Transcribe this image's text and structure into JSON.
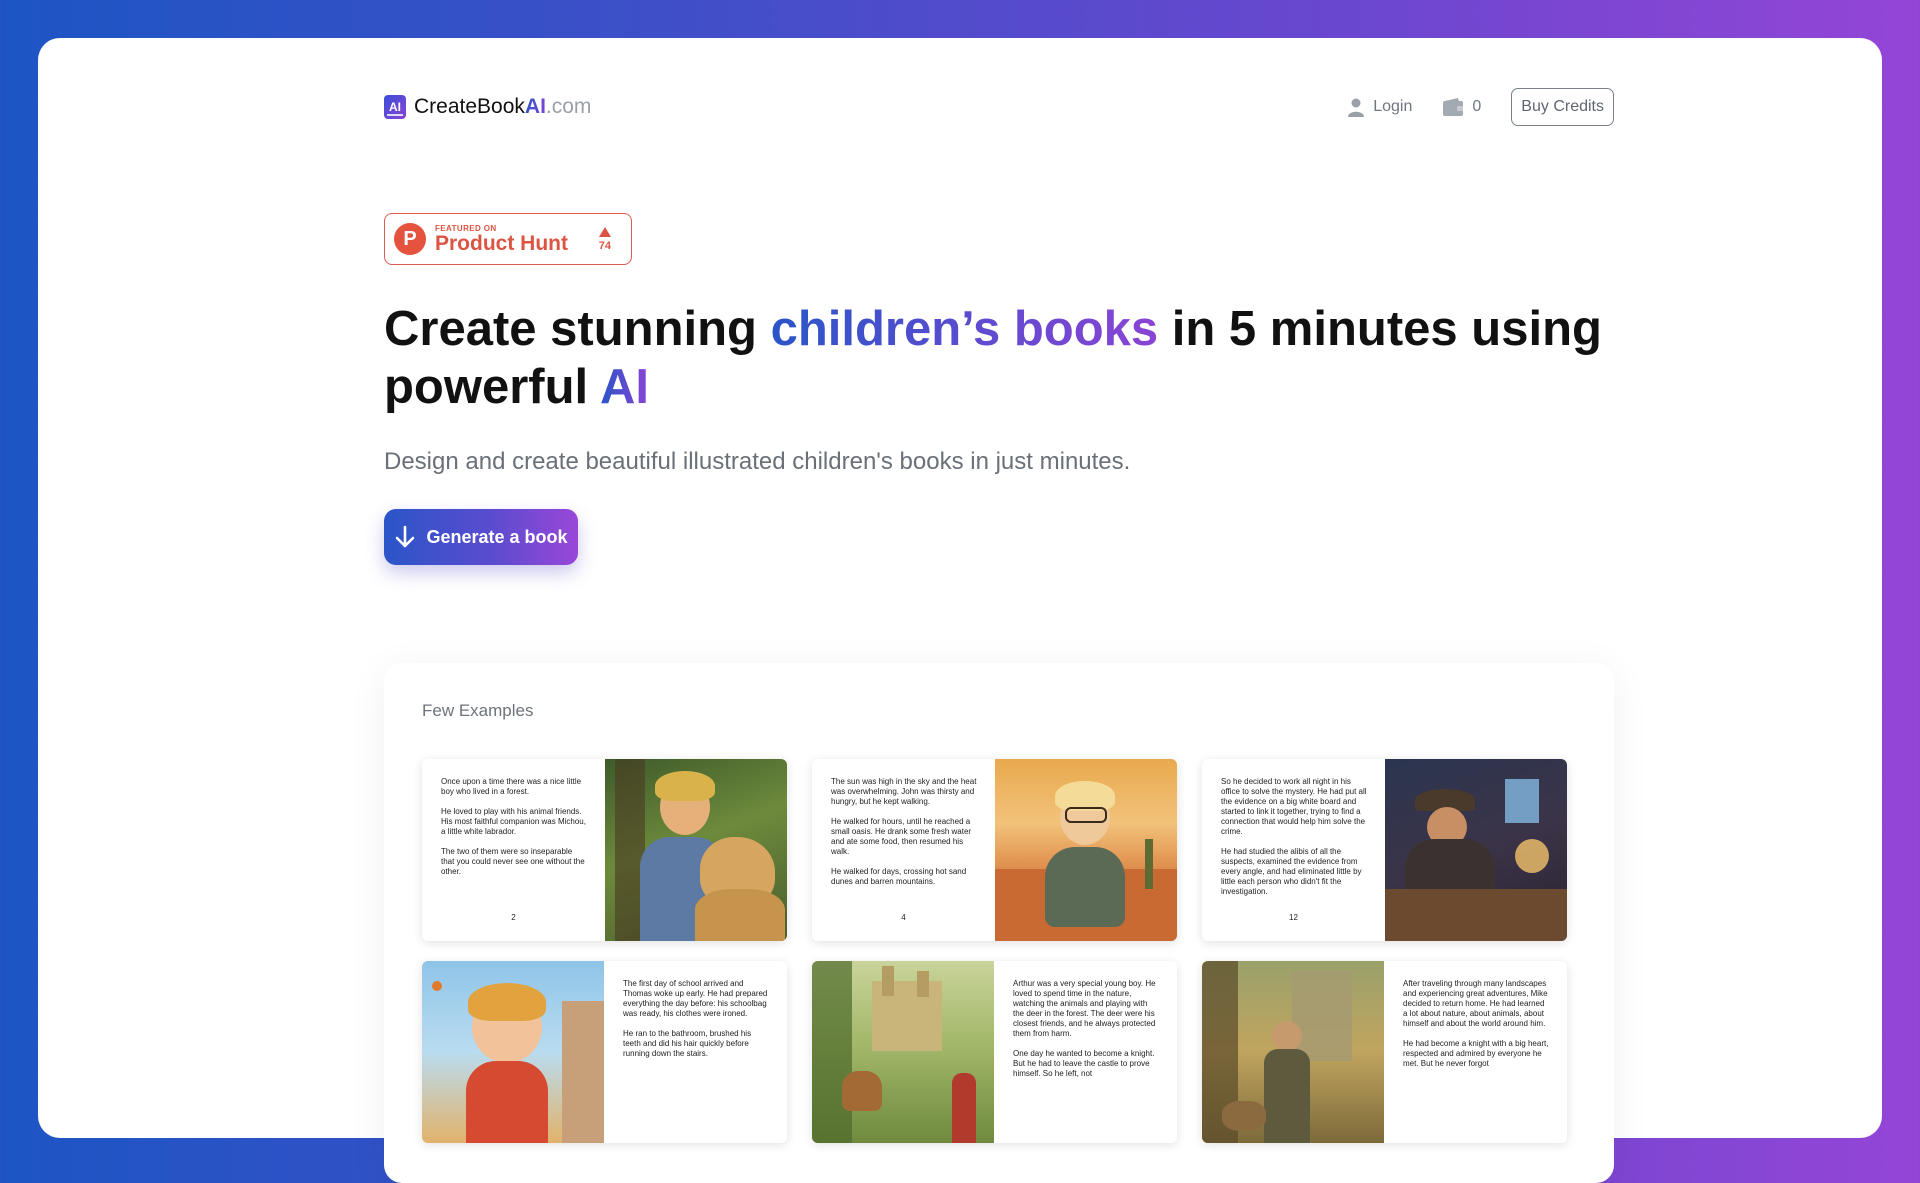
{
  "header": {
    "logo_mark": "AI",
    "logo_text": "CreateBook",
    "logo_ai": "AI",
    "logo_domain": ".com",
    "login_label": "Login",
    "credits_count": "0",
    "buy_credits_label": "Buy Credits"
  },
  "product_hunt": {
    "logo_letter": "P",
    "featured_label": "FEATURED ON",
    "name": "Product Hunt",
    "votes": "74"
  },
  "hero": {
    "title_part1": "Create stunning ",
    "title_highlight": "children’s books",
    "title_part2": " in 5 minutes using powerful ",
    "title_ai": "AI",
    "subtitle": "Design and create beautiful illustrated children's books in just minutes.",
    "cta_label": "Generate a book"
  },
  "examples": {
    "title": "Few Examples",
    "books": [
      {
        "paragraphs": [
          "Once upon a time there was a nice little boy who lived in a forest.",
          "He loved to play with his animal friends. His most faithful companion was Michou, a little white labrador.",
          "The two of them were so inseparable that you could never see one without the other."
        ],
        "page_number": "2",
        "illustration": "boy-with-dog-in-forest"
      },
      {
        "paragraphs": [
          "The sun was high in the sky and the heat was overwhelming. John was thirsty and hungry, but he kept walking.",
          "He walked for hours, until he reached a small oasis. He drank some fresh water and ate some food, then resumed his walk.",
          "He walked for days, crossing hot sand dunes and barren mountains."
        ],
        "page_number": "4",
        "illustration": "boy-in-desert"
      },
      {
        "paragraphs": [
          "So he decided to work all night in his office to solve the mystery. He had put all the evidence on a big white board and started to link it together, trying to find a connection that would help him solve the crime.",
          "He had studied the alibis of all the suspects, examined the evidence from every angle, and had eliminated little by little each person who didn't fit the investigation."
        ],
        "page_number": "12",
        "illustration": "detective-at-desk"
      },
      {
        "paragraphs": [
          "The first day of school arrived and Thomas woke up early. He had prepared everything the day before: his schoolbag was ready, his clothes were ironed.",
          "He ran to the bathroom, brushed his teeth and did his hair quickly before running down the stairs."
        ],
        "page_number": "",
        "illustration": "happy-boy-autumn"
      },
      {
        "paragraphs": [
          "Arthur was a very special young boy. He loved to spend time in the nature, watching the animals and playing with the deer in the forest. The deer were his closest friends, and he always protected them from harm.",
          "One day he wanted to become a knight. But he had to leave the castle to prove himself. So he left, not"
        ],
        "page_number": "",
        "illustration": "castle-and-deer"
      },
      {
        "paragraphs": [
          "After traveling through many landscapes and experiencing great adventures, Mike decided to return home. He had learned a lot about nature, about animals, about himself and about the world around him.",
          "He had become a knight with a big heart, respected and admired by everyone he met. But he never forgot"
        ],
        "page_number": "",
        "illustration": "knight-with-dog"
      }
    ]
  }
}
